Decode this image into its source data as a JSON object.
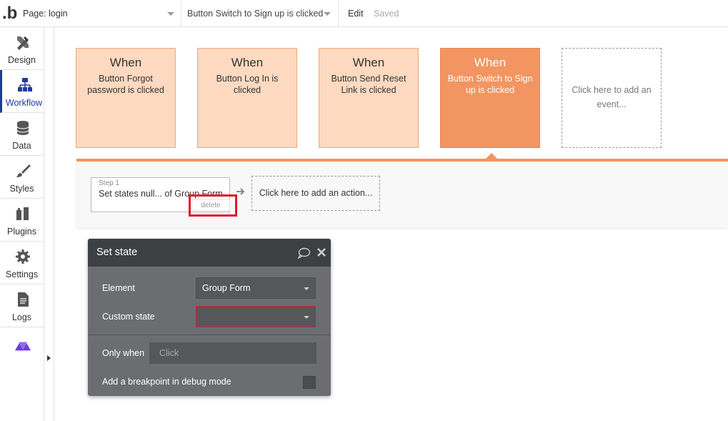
{
  "topbar": {
    "logo": "b",
    "page_select": "Page: login",
    "workflow_select": "Button Switch to Sign up is clicked",
    "edit": "Edit",
    "saved": "Saved"
  },
  "sidebar": {
    "items": [
      {
        "label": "Design",
        "icon": "design-icon"
      },
      {
        "label": "Workflow",
        "icon": "workflow-icon"
      },
      {
        "label": "Data",
        "icon": "database-icon"
      },
      {
        "label": "Styles",
        "icon": "brush-icon"
      },
      {
        "label": "Plugins",
        "icon": "plugin-icon"
      },
      {
        "label": "Settings",
        "icon": "gear-icon"
      },
      {
        "label": "Logs",
        "icon": "document-icon"
      }
    ],
    "active_index": 1,
    "active_color": "#1f3a9e"
  },
  "events": [
    {
      "when": "When",
      "desc": "Button Forgot password is clicked"
    },
    {
      "when": "When",
      "desc": "Button Log In is clicked"
    },
    {
      "when": "When",
      "desc": "Button Send Reset Link is clicked"
    },
    {
      "when": "When",
      "desc": "Button Switch to Sign up is clicked"
    }
  ],
  "active_event_index": 3,
  "add_event": "Click here to add an event...",
  "actions": {
    "step_label": "Step 1",
    "step_text": "Set states null... of Group Form",
    "delete_label": "delete",
    "add_action": "Click here to add an action..."
  },
  "panel": {
    "title": "Set state",
    "element_label": "Element",
    "element_value": "Group Form",
    "custom_state_label": "Custom state",
    "custom_state_value": "",
    "only_when_label": "Only when",
    "only_when_placeholder": "Click",
    "breakpoint_label": "Add a breakpoint in debug mode"
  },
  "colors": {
    "event_card": "#fdd9c0",
    "event_card_active": "#f29561",
    "highlight": "#e0182b",
    "panel_bg": "#6b6d70",
    "panel_head": "#3d4043"
  }
}
